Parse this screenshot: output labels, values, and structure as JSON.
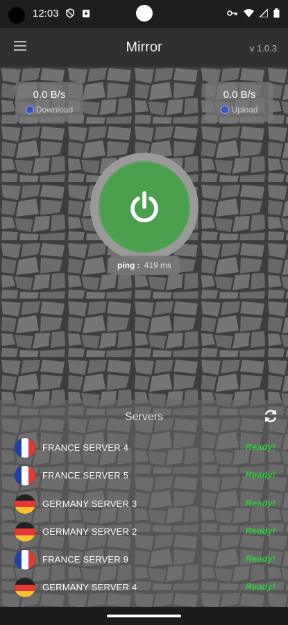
{
  "status_bar": {
    "time": "12:03"
  },
  "app_bar": {
    "title": "Mirror",
    "version": "v 1.0.3"
  },
  "speed": {
    "download": {
      "value": "0.0 B/s",
      "label": "Download"
    },
    "upload": {
      "value": "0.0 B/s",
      "label": "Upload"
    }
  },
  "ping": {
    "label": "ping :",
    "value": "419 ms"
  },
  "servers": {
    "title": "Servers",
    "items": [
      {
        "name": "FRANCE SERVER 4",
        "status": "Ready!",
        "flag": "france"
      },
      {
        "name": "FRANCE SERVER 5",
        "status": "Ready!",
        "flag": "france"
      },
      {
        "name": "GERMANY SERVER 3",
        "status": "Ready!",
        "flag": "germany"
      },
      {
        "name": "GERMANY SERVER 2",
        "status": "Ready!",
        "flag": "germany"
      },
      {
        "name": "FRANCE SERVER 9",
        "status": "Ready!",
        "flag": "france"
      },
      {
        "name": "GERMANY SERVER 4",
        "status": "Ready!",
        "flag": "germany"
      }
    ]
  },
  "colors": {
    "power_green": "#4d9f50",
    "status_green": "#2ecc40",
    "app_bar": "#303030"
  }
}
